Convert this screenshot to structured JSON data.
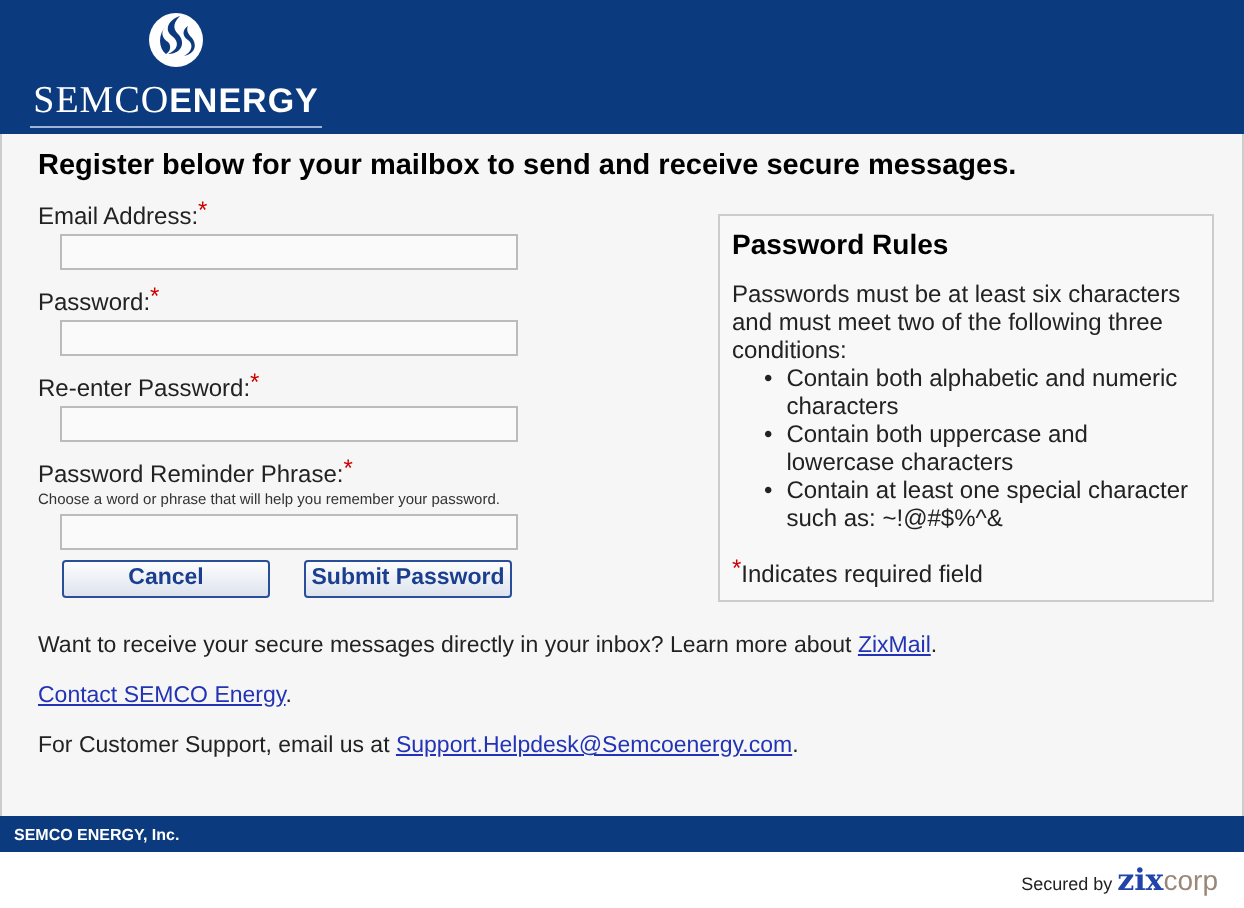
{
  "header": {
    "logo_text": "SEMCO**ENERGY**"
  },
  "heading": "Register below for your mailbox to send and receive secure messages.",
  "fields": [
    {
      "label": "Email Address:",
      "required_mark": "*"
    },
    {
      "label": "Password:",
      "required_mark": "*"
    },
    {
      "label": "Re-enter Password:",
      "required_mark": "*"
    },
    {
      "label": "Password Reminder Phrase:",
      "required_mark": "*",
      "hint": "Choose a word or phrase that will help you remember your password."
    }
  ],
  "buttons": [
    "Cancel",
    "Submit Password"
  ],
  "rules": {
    "title": "Password Rules",
    "intro": "Passwords must be at least six characters and must meet two of the following three conditions:",
    "bullet": "•",
    "items": [
      "Contain both alphabetic and numeric characters",
      "Contain both uppercase and lowercase characters",
      "Contain at least one special character such as: ~!@#$%^&"
    ],
    "required_mark": "*",
    "required_note": "Indicates required field"
  },
  "info": [
    {
      "before": "Want to receive your secure messages directly in your inbox? Learn more about ",
      "link": "ZixMail",
      "after": "."
    },
    {
      "link": "Contact SEMCO Energy",
      "after": "."
    },
    {
      "before": "For Customer Support, email us at ",
      "link": "Support.Helpdesk@Semcoenergy.com",
      "after": "."
    }
  ],
  "footer": "SEMCO ENERGY, Inc.",
  "secured": {
    "label": "Secured by",
    "brand": "**zix**corp"
  }
}
